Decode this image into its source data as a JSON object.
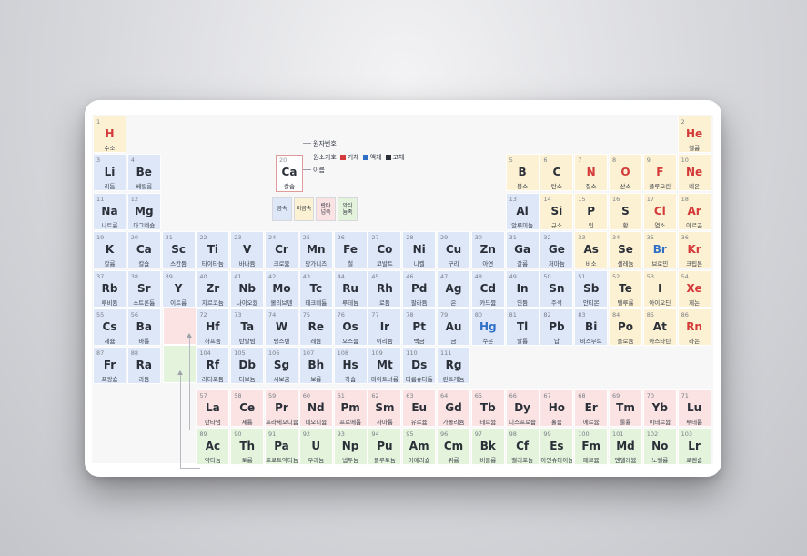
{
  "legend": {
    "sample": {
      "number": "20",
      "symbol": "Ca",
      "name": "칼슘"
    },
    "labels": {
      "number": "원자번호",
      "symbol": "원소기호",
      "name": "이름"
    },
    "states": [
      {
        "label": "기체",
        "color": "#d43a3a"
      },
      {
        "label": "액체",
        "color": "#2f6fc6"
      },
      {
        "label": "고체",
        "color": "#2a2f38"
      }
    ],
    "categories": [
      {
        "label": "금속",
        "color": "#dde7f8"
      },
      {
        "label": "비금속",
        "color": "#fcf1d2"
      },
      {
        "label": "란타넘족",
        "color": "#fbe3e3"
      },
      {
        "label": "악티늄족",
        "color": "#e3f3dc"
      }
    ]
  },
  "colors": {
    "metal": "#dde7f8",
    "nonmetal": "#fcf1d2",
    "lanthanide": "#fbe3e3",
    "actinide": "#e3f3dc",
    "gas": "#d43a3a",
    "liquid": "#2f6fc6",
    "solid": "#2a2f38"
  },
  "elements": [
    {
      "n": "1",
      "s": "H",
      "k": "수소",
      "r": 1,
      "c": 1,
      "cat": "nonmetal",
      "st": "gas"
    },
    {
      "n": "2",
      "s": "He",
      "k": "헬륨",
      "r": 1,
      "c": 18,
      "cat": "nonmetal",
      "st": "gas"
    },
    {
      "n": "3",
      "s": "Li",
      "k": "리튬",
      "r": 2,
      "c": 1,
      "cat": "metal",
      "st": "solid"
    },
    {
      "n": "4",
      "s": "Be",
      "k": "베릴륨",
      "r": 2,
      "c": 2,
      "cat": "metal",
      "st": "solid"
    },
    {
      "n": "5",
      "s": "B",
      "k": "붕소",
      "r": 2,
      "c": 13,
      "cat": "nonmetal",
      "st": "solid"
    },
    {
      "n": "6",
      "s": "C",
      "k": "탄소",
      "r": 2,
      "c": 14,
      "cat": "nonmetal",
      "st": "solid"
    },
    {
      "n": "7",
      "s": "N",
      "k": "질소",
      "r": 2,
      "c": 15,
      "cat": "nonmetal",
      "st": "gas"
    },
    {
      "n": "8",
      "s": "O",
      "k": "산소",
      "r": 2,
      "c": 16,
      "cat": "nonmetal",
      "st": "gas"
    },
    {
      "n": "9",
      "s": "F",
      "k": "플루오린",
      "r": 2,
      "c": 17,
      "cat": "nonmetal",
      "st": "gas"
    },
    {
      "n": "10",
      "s": "Ne",
      "k": "네온",
      "r": 2,
      "c": 18,
      "cat": "nonmetal",
      "st": "gas"
    },
    {
      "n": "11",
      "s": "Na",
      "k": "나트륨",
      "r": 3,
      "c": 1,
      "cat": "metal",
      "st": "solid"
    },
    {
      "n": "12",
      "s": "Mg",
      "k": "마그네슘",
      "r": 3,
      "c": 2,
      "cat": "metal",
      "st": "solid"
    },
    {
      "n": "13",
      "s": "Al",
      "k": "알루미늄",
      "r": 3,
      "c": 13,
      "cat": "metal",
      "st": "solid"
    },
    {
      "n": "14",
      "s": "Si",
      "k": "규소",
      "r": 3,
      "c": 14,
      "cat": "nonmetal",
      "st": "solid"
    },
    {
      "n": "15",
      "s": "P",
      "k": "인",
      "r": 3,
      "c": 15,
      "cat": "nonmetal",
      "st": "solid"
    },
    {
      "n": "16",
      "s": "S",
      "k": "황",
      "r": 3,
      "c": 16,
      "cat": "nonmetal",
      "st": "solid"
    },
    {
      "n": "17",
      "s": "Cl",
      "k": "염소",
      "r": 3,
      "c": 17,
      "cat": "nonmetal",
      "st": "gas"
    },
    {
      "n": "18",
      "s": "Ar",
      "k": "아르곤",
      "r": 3,
      "c": 18,
      "cat": "nonmetal",
      "st": "gas"
    },
    {
      "n": "19",
      "s": "K",
      "k": "칼륨",
      "r": 4,
      "c": 1,
      "cat": "metal",
      "st": "solid"
    },
    {
      "n": "20",
      "s": "Ca",
      "k": "칼슘",
      "r": 4,
      "c": 2,
      "cat": "metal",
      "st": "solid"
    },
    {
      "n": "21",
      "s": "Sc",
      "k": "스칸듐",
      "r": 4,
      "c": 3,
      "cat": "metal",
      "st": "solid"
    },
    {
      "n": "22",
      "s": "Ti",
      "k": "타이타늄",
      "r": 4,
      "c": 4,
      "cat": "metal",
      "st": "solid"
    },
    {
      "n": "23",
      "s": "V",
      "k": "바나듐",
      "r": 4,
      "c": 5,
      "cat": "metal",
      "st": "solid"
    },
    {
      "n": "24",
      "s": "Cr",
      "k": "크로뮴",
      "r": 4,
      "c": 6,
      "cat": "metal",
      "st": "solid"
    },
    {
      "n": "25",
      "s": "Mn",
      "k": "망가니즈",
      "r": 4,
      "c": 7,
      "cat": "metal",
      "st": "solid"
    },
    {
      "n": "26",
      "s": "Fe",
      "k": "철",
      "r": 4,
      "c": 8,
      "cat": "metal",
      "st": "solid"
    },
    {
      "n": "27",
      "s": "Co",
      "k": "코발트",
      "r": 4,
      "c": 9,
      "cat": "metal",
      "st": "solid"
    },
    {
      "n": "28",
      "s": "Ni",
      "k": "니켈",
      "r": 4,
      "c": 10,
      "cat": "metal",
      "st": "solid"
    },
    {
      "n": "29",
      "s": "Cu",
      "k": "구리",
      "r": 4,
      "c": 11,
      "cat": "metal",
      "st": "solid"
    },
    {
      "n": "30",
      "s": "Zn",
      "k": "아연",
      "r": 4,
      "c": 12,
      "cat": "metal",
      "st": "solid"
    },
    {
      "n": "31",
      "s": "Ga",
      "k": "갈륨",
      "r": 4,
      "c": 13,
      "cat": "metal",
      "st": "solid"
    },
    {
      "n": "32",
      "s": "Ge",
      "k": "저마늄",
      "r": 4,
      "c": 14,
      "cat": "metal",
      "st": "solid"
    },
    {
      "n": "33",
      "s": "As",
      "k": "비소",
      "r": 4,
      "c": 15,
      "cat": "nonmetal",
      "st": "solid"
    },
    {
      "n": "34",
      "s": "Se",
      "k": "셀레늄",
      "r": 4,
      "c": 16,
      "cat": "nonmetal",
      "st": "solid"
    },
    {
      "n": "35",
      "s": "Br",
      "k": "브로민",
      "r": 4,
      "c": 17,
      "cat": "nonmetal",
      "st": "liquid"
    },
    {
      "n": "36",
      "s": "Kr",
      "k": "크립톤",
      "r": 4,
      "c": 18,
      "cat": "nonmetal",
      "st": "gas"
    },
    {
      "n": "37",
      "s": "Rb",
      "k": "루비듐",
      "r": 5,
      "c": 1,
      "cat": "metal",
      "st": "solid"
    },
    {
      "n": "38",
      "s": "Sr",
      "k": "스트론튬",
      "r": 5,
      "c": 2,
      "cat": "metal",
      "st": "solid"
    },
    {
      "n": "39",
      "s": "Y",
      "k": "이트륨",
      "r": 5,
      "c": 3,
      "cat": "metal",
      "st": "solid"
    },
    {
      "n": "40",
      "s": "Zr",
      "k": "지르코늄",
      "r": 5,
      "c": 4,
      "cat": "metal",
      "st": "solid"
    },
    {
      "n": "41",
      "s": "Nb",
      "k": "나이오븀",
      "r": 5,
      "c": 5,
      "cat": "metal",
      "st": "solid"
    },
    {
      "n": "42",
      "s": "Mo",
      "k": "몰리브덴",
      "r": 5,
      "c": 6,
      "cat": "metal",
      "st": "solid"
    },
    {
      "n": "43",
      "s": "Tc",
      "k": "테크네튬",
      "r": 5,
      "c": 7,
      "cat": "metal",
      "st": "solid"
    },
    {
      "n": "44",
      "s": "Ru",
      "k": "루테늄",
      "r": 5,
      "c": 8,
      "cat": "metal",
      "st": "solid"
    },
    {
      "n": "45",
      "s": "Rh",
      "k": "로듐",
      "r": 5,
      "c": 9,
      "cat": "metal",
      "st": "solid"
    },
    {
      "n": "46",
      "s": "Pd",
      "k": "팔라듐",
      "r": 5,
      "c": 10,
      "cat": "metal",
      "st": "solid"
    },
    {
      "n": "47",
      "s": "Ag",
      "k": "은",
      "r": 5,
      "c": 11,
      "cat": "metal",
      "st": "solid"
    },
    {
      "n": "48",
      "s": "Cd",
      "k": "카드뮴",
      "r": 5,
      "c": 12,
      "cat": "metal",
      "st": "solid"
    },
    {
      "n": "49",
      "s": "In",
      "k": "인듐",
      "r": 5,
      "c": 13,
      "cat": "metal",
      "st": "solid"
    },
    {
      "n": "50",
      "s": "Sn",
      "k": "주석",
      "r": 5,
      "c": 14,
      "cat": "metal",
      "st": "solid"
    },
    {
      "n": "51",
      "s": "Sb",
      "k": "안티몬",
      "r": 5,
      "c": 15,
      "cat": "metal",
      "st": "solid"
    },
    {
      "n": "52",
      "s": "Te",
      "k": "텔루륨",
      "r": 5,
      "c": 16,
      "cat": "nonmetal",
      "st": "solid"
    },
    {
      "n": "53",
      "s": "I",
      "k": "아이오딘",
      "r": 5,
      "c": 17,
      "cat": "nonmetal",
      "st": "solid"
    },
    {
      "n": "54",
      "s": "Xe",
      "k": "제논",
      "r": 5,
      "c": 18,
      "cat": "nonmetal",
      "st": "gas"
    },
    {
      "n": "55",
      "s": "Cs",
      "k": "세슘",
      "r": 6,
      "c": 1,
      "cat": "metal",
      "st": "solid"
    },
    {
      "n": "56",
      "s": "Ba",
      "k": "바륨",
      "r": 6,
      "c": 2,
      "cat": "metal",
      "st": "solid"
    },
    {
      "n": "72",
      "s": "Hf",
      "k": "하프늄",
      "r": 6,
      "c": 4,
      "cat": "metal",
      "st": "solid"
    },
    {
      "n": "73",
      "s": "Ta",
      "k": "탄탈럼",
      "r": 6,
      "c": 5,
      "cat": "metal",
      "st": "solid"
    },
    {
      "n": "74",
      "s": "W",
      "k": "텅스텐",
      "r": 6,
      "c": 6,
      "cat": "metal",
      "st": "solid"
    },
    {
      "n": "75",
      "s": "Re",
      "k": "레늄",
      "r": 6,
      "c": 7,
      "cat": "metal",
      "st": "solid"
    },
    {
      "n": "76",
      "s": "Os",
      "k": "오스뮴",
      "r": 6,
      "c": 8,
      "cat": "metal",
      "st": "solid"
    },
    {
      "n": "77",
      "s": "Ir",
      "k": "이리듐",
      "r": 6,
      "c": 9,
      "cat": "metal",
      "st": "solid"
    },
    {
      "n": "78",
      "s": "Pt",
      "k": "백금",
      "r": 6,
      "c": 10,
      "cat": "metal",
      "st": "solid"
    },
    {
      "n": "79",
      "s": "Au",
      "k": "금",
      "r": 6,
      "c": 11,
      "cat": "metal",
      "st": "solid"
    },
    {
      "n": "80",
      "s": "Hg",
      "k": "수은",
      "r": 6,
      "c": 12,
      "cat": "metal",
      "st": "liquid"
    },
    {
      "n": "81",
      "s": "Tl",
      "k": "탈륨",
      "r": 6,
      "c": 13,
      "cat": "metal",
      "st": "solid"
    },
    {
      "n": "82",
      "s": "Pb",
      "k": "납",
      "r": 6,
      "c": 14,
      "cat": "metal",
      "st": "solid"
    },
    {
      "n": "83",
      "s": "Bi",
      "k": "비스무트",
      "r": 6,
      "c": 15,
      "cat": "metal",
      "st": "solid"
    },
    {
      "n": "84",
      "s": "Po",
      "k": "폴로늄",
      "r": 6,
      "c": 16,
      "cat": "nonmetal",
      "st": "solid"
    },
    {
      "n": "85",
      "s": "At",
      "k": "아스타틴",
      "r": 6,
      "c": 17,
      "cat": "nonmetal",
      "st": "solid"
    },
    {
      "n": "86",
      "s": "Rn",
      "k": "라돈",
      "r": 6,
      "c": 18,
      "cat": "nonmetal",
      "st": "gas"
    },
    {
      "n": "87",
      "s": "Fr",
      "k": "프랑슘",
      "r": 7,
      "c": 1,
      "cat": "metal",
      "st": "solid"
    },
    {
      "n": "88",
      "s": "Ra",
      "k": "라듐",
      "r": 7,
      "c": 2,
      "cat": "metal",
      "st": "solid"
    },
    {
      "n": "104",
      "s": "Rf",
      "k": "러더포듐",
      "r": 7,
      "c": 4,
      "cat": "metal",
      "st": "solid"
    },
    {
      "n": "105",
      "s": "Db",
      "k": "더브늄",
      "r": 7,
      "c": 5,
      "cat": "metal",
      "st": "solid"
    },
    {
      "n": "106",
      "s": "Sg",
      "k": "시보귬",
      "r": 7,
      "c": 6,
      "cat": "metal",
      "st": "solid"
    },
    {
      "n": "107",
      "s": "Bh",
      "k": "보륨",
      "r": 7,
      "c": 7,
      "cat": "metal",
      "st": "solid"
    },
    {
      "n": "108",
      "s": "Hs",
      "k": "하슘",
      "r": 7,
      "c": 8,
      "cat": "metal",
      "st": "solid"
    },
    {
      "n": "109",
      "s": "Mt",
      "k": "마이트너륨",
      "r": 7,
      "c": 9,
      "cat": "metal",
      "st": "solid"
    },
    {
      "n": "110",
      "s": "Ds",
      "k": "다름슈타튬",
      "r": 7,
      "c": 10,
      "cat": "metal",
      "st": "solid"
    },
    {
      "n": "111",
      "s": "Rg",
      "k": "뢴트게늄",
      "r": 7,
      "c": 11,
      "cat": "metal",
      "st": "solid"
    },
    {
      "n": "57",
      "s": "La",
      "k": "란타넘",
      "r": 8,
      "c": 4,
      "cat": "lanth",
      "st": "solid"
    },
    {
      "n": "58",
      "s": "Ce",
      "k": "세륨",
      "r": 8,
      "c": 5,
      "cat": "lanth",
      "st": "solid"
    },
    {
      "n": "59",
      "s": "Pr",
      "k": "프라세오디뮴",
      "r": 8,
      "c": 6,
      "cat": "lanth",
      "st": "solid"
    },
    {
      "n": "60",
      "s": "Nd",
      "k": "네오디뮴",
      "r": 8,
      "c": 7,
      "cat": "lanth",
      "st": "solid"
    },
    {
      "n": "61",
      "s": "Pm",
      "k": "프로메튬",
      "r": 8,
      "c": 8,
      "cat": "lanth",
      "st": "solid"
    },
    {
      "n": "62",
      "s": "Sm",
      "k": "사마륨",
      "r": 8,
      "c": 9,
      "cat": "lanth",
      "st": "solid"
    },
    {
      "n": "63",
      "s": "Eu",
      "k": "유로퓸",
      "r": 8,
      "c": 10,
      "cat": "lanth",
      "st": "solid"
    },
    {
      "n": "64",
      "s": "Gd",
      "k": "가돌리늄",
      "r": 8,
      "c": 11,
      "cat": "lanth",
      "st": "solid"
    },
    {
      "n": "65",
      "s": "Tb",
      "k": "테르븀",
      "r": 8,
      "c": 12,
      "cat": "lanth",
      "st": "solid"
    },
    {
      "n": "66",
      "s": "Dy",
      "k": "디스프로슘",
      "r": 8,
      "c": 13,
      "cat": "lanth",
      "st": "solid"
    },
    {
      "n": "67",
      "s": "Ho",
      "k": "홀뮴",
      "r": 8,
      "c": 14,
      "cat": "lanth",
      "st": "solid"
    },
    {
      "n": "68",
      "s": "Er",
      "k": "에르븀",
      "r": 8,
      "c": 15,
      "cat": "lanth",
      "st": "solid"
    },
    {
      "n": "69",
      "s": "Tm",
      "k": "툴륨",
      "r": 8,
      "c": 16,
      "cat": "lanth",
      "st": "solid"
    },
    {
      "n": "70",
      "s": "Yb",
      "k": "이테르븀",
      "r": 8,
      "c": 17,
      "cat": "lanth",
      "st": "solid"
    },
    {
      "n": "71",
      "s": "Lu",
      "k": "루테튬",
      "r": 8,
      "c": 18,
      "cat": "lanth",
      "st": "solid"
    },
    {
      "n": "89",
      "s": "Ac",
      "k": "악티늄",
      "r": 9,
      "c": 4,
      "cat": "actin",
      "st": "solid"
    },
    {
      "n": "90",
      "s": "Th",
      "k": "토륨",
      "r": 9,
      "c": 5,
      "cat": "actin",
      "st": "solid"
    },
    {
      "n": "91",
      "s": "Pa",
      "k": "프로트악티늄",
      "r": 9,
      "c": 6,
      "cat": "actin",
      "st": "solid"
    },
    {
      "n": "92",
      "s": "U",
      "k": "우라늄",
      "r": 9,
      "c": 7,
      "cat": "actin",
      "st": "solid"
    },
    {
      "n": "93",
      "s": "Np",
      "k": "넵투늄",
      "r": 9,
      "c": 8,
      "cat": "actin",
      "st": "solid"
    },
    {
      "n": "94",
      "s": "Pu",
      "k": "플루토늄",
      "r": 9,
      "c": 9,
      "cat": "actin",
      "st": "solid"
    },
    {
      "n": "95",
      "s": "Am",
      "k": "아메리슘",
      "r": 9,
      "c": 10,
      "cat": "actin",
      "st": "solid"
    },
    {
      "n": "96",
      "s": "Cm",
      "k": "퀴륨",
      "r": 9,
      "c": 11,
      "cat": "actin",
      "st": "solid"
    },
    {
      "n": "97",
      "s": "Bk",
      "k": "버클륨",
      "r": 9,
      "c": 12,
      "cat": "actin",
      "st": "solid"
    },
    {
      "n": "98",
      "s": "Cf",
      "k": "캘리포늄",
      "r": 9,
      "c": 13,
      "cat": "actin",
      "st": "solid"
    },
    {
      "n": "99",
      "s": "Es",
      "k": "아인슈타이늄",
      "r": 9,
      "c": 14,
      "cat": "actin",
      "st": "solid"
    },
    {
      "n": "100",
      "s": "Fm",
      "k": "페르뮴",
      "r": 9,
      "c": 15,
      "cat": "actin",
      "st": "solid"
    },
    {
      "n": "101",
      "s": "Md",
      "k": "멘델레븀",
      "r": 9,
      "c": 16,
      "cat": "actin",
      "st": "solid"
    },
    {
      "n": "102",
      "s": "No",
      "k": "노벨륨",
      "r": 9,
      "c": 17,
      "cat": "actin",
      "st": "solid"
    },
    {
      "n": "103",
      "s": "Lr",
      "k": "로렌슘",
      "r": 9,
      "c": 18,
      "cat": "actin",
      "st": "solid"
    }
  ]
}
